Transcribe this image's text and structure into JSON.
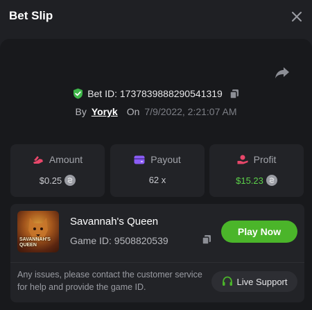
{
  "header": {
    "title": "Bet Slip",
    "close_icon": "close-icon"
  },
  "bet": {
    "id_label": "Bet ID: 1737839888290541319",
    "by_label": "By",
    "user": "Yoryk",
    "on_label": "On",
    "date": "7/9/2022, 2:21:07 AM",
    "share_icon": "share-icon",
    "verified_icon": "shield-check-icon",
    "copy_icon": "copy-icon"
  },
  "stats": {
    "amount": {
      "label": "Amount",
      "value": "$0.25",
      "icon": "amount-icon",
      "icon_color": "#e8476a"
    },
    "payout": {
      "label": "Payout",
      "value": "62 x",
      "icon": "wallet-icon",
      "icon_color": "#8b5cf6"
    },
    "profit": {
      "label": "Profit",
      "value": "$15.23",
      "icon": "profit-icon",
      "icon_color": "#e8476a"
    }
  },
  "game": {
    "name": "Savannah's Queen",
    "thumb_text": "SAVANNAH'S QUEEN",
    "id_label": "Game ID: 9508820539",
    "play_label": "Play Now",
    "help_text": "Any issues, please contact the customer service for help and provide the game ID.",
    "support_label": "Live Support",
    "support_icon": "headset-icon"
  },
  "colors": {
    "accent_green": "#4bb52a",
    "profit_green": "#5cd14a",
    "background": "#1f2024",
    "panel": "#18191c",
    "card": "#222327"
  }
}
